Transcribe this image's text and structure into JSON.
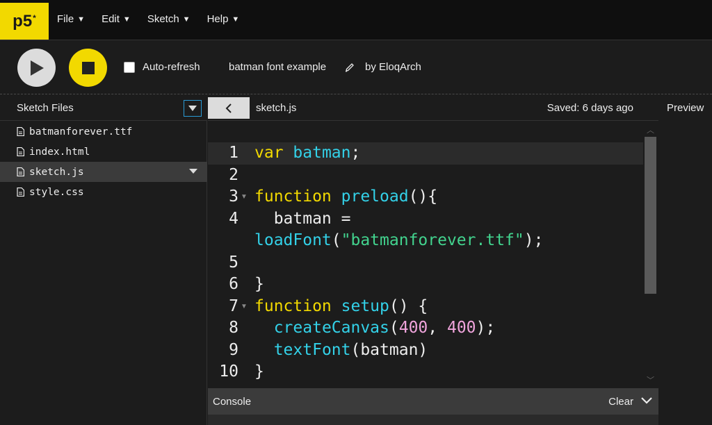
{
  "app": {
    "logo": "p5",
    "logo_sup": "*"
  },
  "menu": [
    {
      "label": "File"
    },
    {
      "label": "Edit"
    },
    {
      "label": "Sketch"
    },
    {
      "label": "Help"
    }
  ],
  "toolbar": {
    "auto_refresh_label": "Auto-refresh",
    "auto_refresh_checked": false,
    "sketch_name": "batman font example",
    "author": "by EloqArch"
  },
  "sidebar": {
    "title": "Sketch Files",
    "files": [
      {
        "name": "batmanforever.ttf",
        "active": false
      },
      {
        "name": "index.html",
        "active": false
      },
      {
        "name": "sketch.js",
        "active": true
      },
      {
        "name": "style.css",
        "active": false
      }
    ]
  },
  "editor": {
    "file_name": "sketch.js",
    "saved_status": "Saved: 6 days ago",
    "lines": [
      {
        "no": "1",
        "code": "var batman;"
      },
      {
        "no": "2",
        "code": ""
      },
      {
        "no": "3",
        "code": "function preload(){"
      },
      {
        "no": "4",
        "code": "  batman ="
      },
      {
        "no": "",
        "code": "loadFont(\"batmanforever.ttf\");"
      },
      {
        "no": "5",
        "code": ""
      },
      {
        "no": "6",
        "code": "}"
      },
      {
        "no": "7",
        "code": "function setup() {"
      },
      {
        "no": "8",
        "code": "  createCanvas(400, 400);"
      },
      {
        "no": "9",
        "code": "  textFont(batman)"
      },
      {
        "no": "10",
        "code": "}"
      }
    ]
  },
  "console": {
    "title": "Console",
    "clear_label": "Clear"
  },
  "preview": {
    "title": "Preview"
  },
  "colors": {
    "accent_yellow": "#f2d900",
    "keyword": "#f2d900",
    "function": "#33d1e8",
    "string": "#42d38e",
    "number": "#f0a4dc"
  }
}
